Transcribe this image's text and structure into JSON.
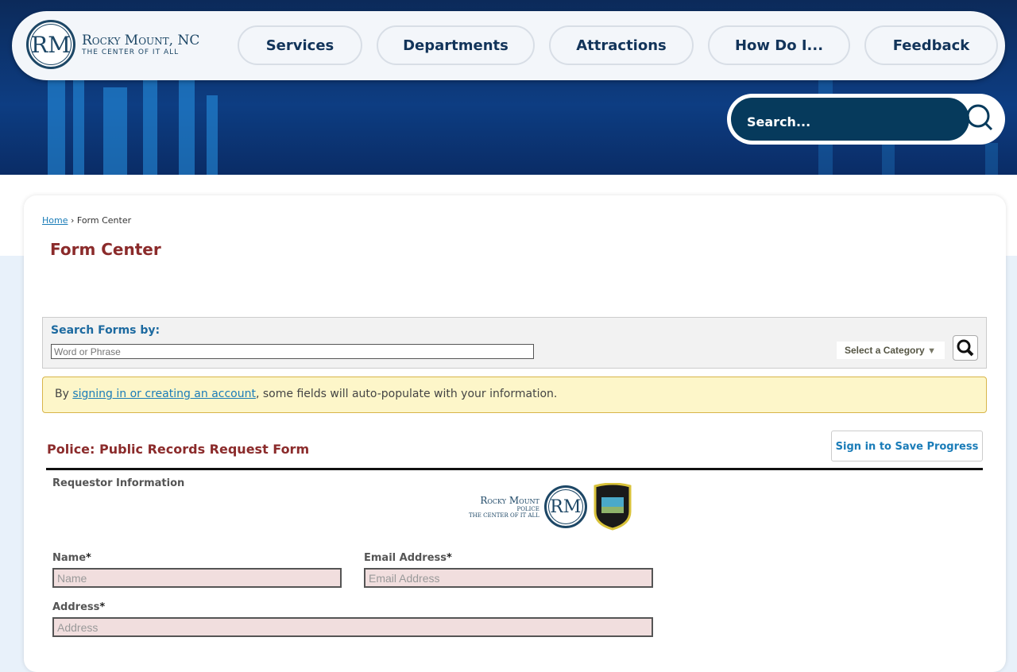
{
  "header": {
    "logo_title": "Rocky Mount, NC",
    "logo_tagline": "The Center of It All",
    "logo_mark": "RM",
    "nav": [
      "Services",
      "Departments",
      "Attractions",
      "How Do I...",
      "Feedback"
    ],
    "search_placeholder": "Search..."
  },
  "breadcrumb": {
    "home": "Home",
    "sep": "›",
    "current": "Form Center"
  },
  "page_title": "Form Center",
  "search_forms": {
    "label": "Search Forms by:",
    "placeholder": "Word or Phrase",
    "category": "Select a Category"
  },
  "notice": {
    "before": "By ",
    "link": "signing in or creating an account",
    "after": ", some fields will auto-populate with your information."
  },
  "form": {
    "title": "Police: Public Records Request Form",
    "save_button": "Sign in to Save Progress",
    "section": "Requestor Information",
    "police_logo": {
      "title": "Rocky Mount",
      "sub": "Police",
      "tagline": "The Center of It All",
      "badge": "Rocky Mount Police"
    },
    "fields": {
      "name_label": "Name",
      "name_placeholder": "Name",
      "email_label": "Email Address",
      "email_placeholder": "Email Address",
      "address_label": "Address",
      "address_placeholder": "Address",
      "required_mark": "*"
    }
  },
  "colors": {
    "accent": "#8b2b2b",
    "link": "#1a7cb8",
    "navy": "#063a5c"
  }
}
